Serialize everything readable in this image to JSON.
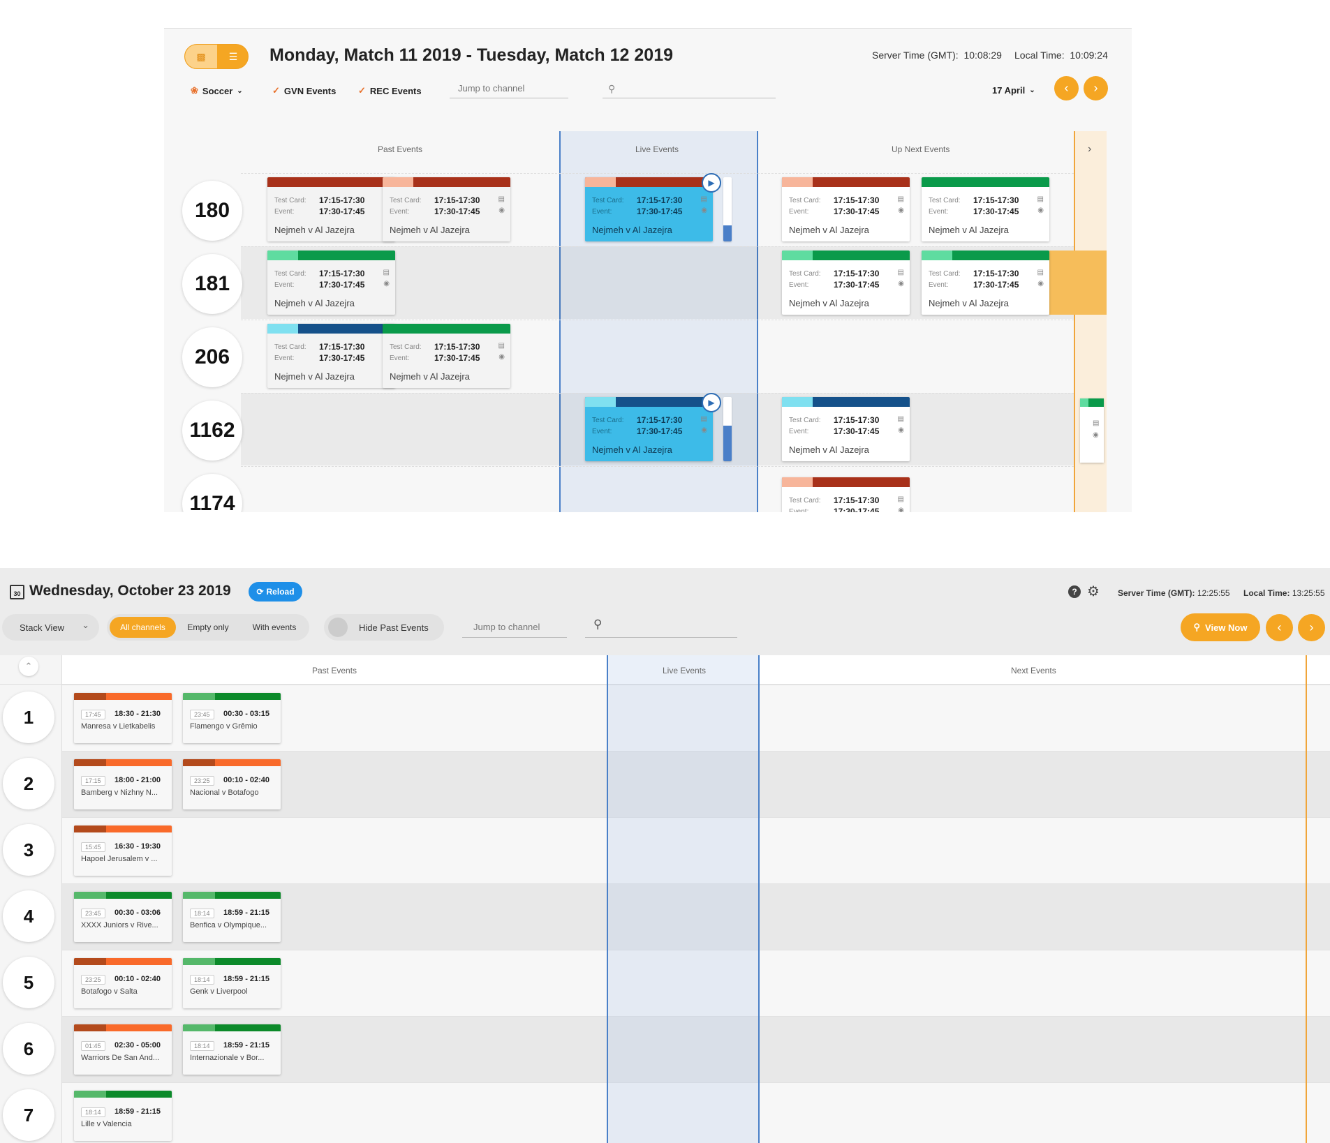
{
  "top": {
    "title": "Monday, Match 11 2019 - Tuesday, Match 12 2019",
    "server_time_label": "Server Time (GMT):",
    "server_time": "10:08:29",
    "local_time_label": "Local Time:",
    "local_time": "10:09:24",
    "sport_filter": "Soccer",
    "gvn_label": "GVN Events",
    "rec_label": "REC Events",
    "jump_placeholder": "Jump to channel",
    "date_select": "17 April",
    "columns": {
      "past": "Past Events",
      "live": "Live Events",
      "next": "Up Next Events"
    },
    "card_labels": {
      "test": "Test Card:",
      "event": "Event:"
    },
    "card_time_test": "17:15-17:30",
    "card_time_event": "17:30-17:45",
    "card_name": "Nejmeh v Al Jazejra",
    "channels": [
      "180",
      "181",
      "206",
      "1162",
      "1174"
    ]
  },
  "bottom": {
    "title": "Wednesday, October 23 2019",
    "calendar_day": "30",
    "reload_label": "Reload",
    "server_time_label": "Server Time (GMT):",
    "server_time": "12:25:55",
    "local_time_label": "Local Time:",
    "local_time": "13:25:55",
    "view_select": "Stack View",
    "seg_all": "All channels",
    "seg_empty": "Empty only",
    "seg_with": "With events",
    "hide_past": "Hide Past Events",
    "jump_placeholder": "Jump to channel",
    "view_now": "View Now",
    "columns": {
      "past": "Past Events",
      "live": "Live Events",
      "next": "Next Events"
    },
    "rows": [
      {
        "num": "1",
        "cards": [
          {
            "start": "17:45",
            "time": "18:30 - 21:30",
            "name": "Manresa v Lietkabelis",
            "color": "orange"
          },
          {
            "start": "23:45",
            "time": "00:30 - 03:15",
            "name": "Flamengo v Grêmio",
            "color": "green"
          }
        ]
      },
      {
        "num": "2",
        "cards": [
          {
            "start": "17:15",
            "time": "18:00 - 21:00",
            "name": "Bamberg v Nizhny N...",
            "color": "orange"
          },
          {
            "start": "23:25",
            "time": "00:10 - 02:40",
            "name": "Nacional v Botafogo",
            "color": "orange"
          }
        ]
      },
      {
        "num": "3",
        "cards": [
          {
            "start": "15:45",
            "time": "16:30 - 19:30",
            "name": "Hapoel Jerusalem v ...",
            "color": "orange"
          }
        ]
      },
      {
        "num": "4",
        "cards": [
          {
            "start": "23:45",
            "time": "00:30 - 03:06",
            "name": "XXXX Juniors v Rive...",
            "color": "green"
          },
          {
            "start": "18:14",
            "time": "18:59 - 21:15",
            "name": "Benfica v Olympique...",
            "color": "green"
          }
        ]
      },
      {
        "num": "5",
        "cards": [
          {
            "start": "23:25",
            "time": "00:10 - 02:40",
            "name": "Botafogo v Salta",
            "color": "orange"
          },
          {
            "start": "18:14",
            "time": "18:59 - 21:15",
            "name": "Genk v Liverpool",
            "color": "green"
          }
        ]
      },
      {
        "num": "6",
        "cards": [
          {
            "start": "01:45",
            "time": "02:30 - 05:00",
            "name": "Warriors De San And...",
            "color": "orange"
          },
          {
            "start": "18:14",
            "time": "18:59 - 21:15",
            "name": "Internazionale v Bor...",
            "color": "green"
          }
        ]
      },
      {
        "num": "7",
        "cards": [
          {
            "start": "18:14",
            "time": "18:59 - 21:15",
            "name": "Lille v Valencia",
            "color": "green"
          }
        ]
      }
    ]
  },
  "colors": {
    "accent": "#f5a623",
    "live_card": "#3dbbe8",
    "live_column": "#e4eaf3",
    "live_border": "#4a80c8",
    "reload": "#1e8fe8"
  }
}
